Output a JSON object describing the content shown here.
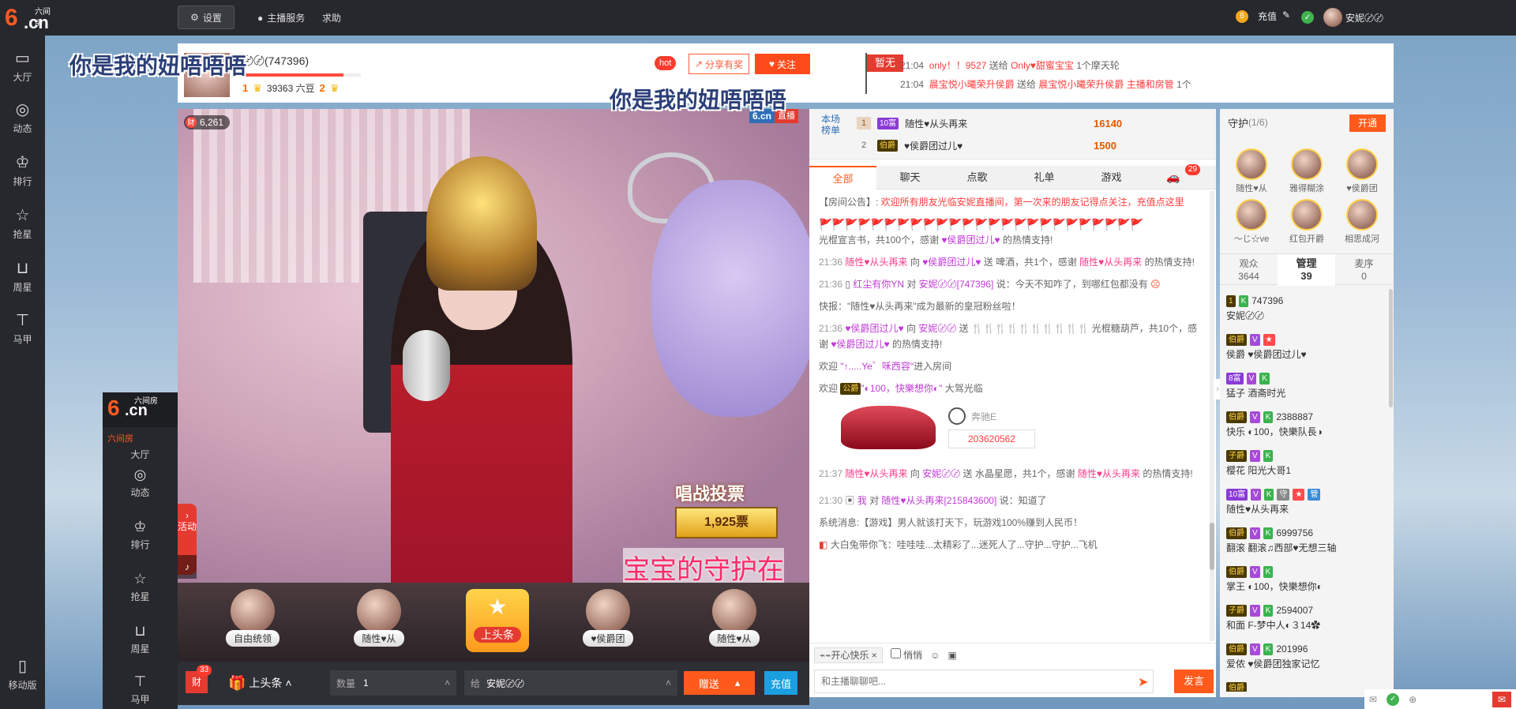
{
  "topbar": {
    "logo_num": "6",
    "logo_cn": ".cn",
    "logo_small": "六间房",
    "settings_label": "设置",
    "host_service_label": "主播服务",
    "help_label": "求助",
    "recharge_label": "充值",
    "username": "安妮〄〄"
  },
  "leftnav": {
    "items": [
      {
        "label": "大厅",
        "icon": "tv-icon"
      },
      {
        "label": "动态",
        "icon": "compass-icon"
      },
      {
        "label": "排行",
        "icon": "crown-icon"
      },
      {
        "label": "抢星",
        "icon": "star-icon"
      },
      {
        "label": "周星",
        "icon": "basket-icon"
      },
      {
        "label": "马甲",
        "icon": "shirt-icon"
      }
    ],
    "mobile_label": "移动版"
  },
  "header": {
    "anchor_name": "〄〄(747396)",
    "anchor_progress_pct": 85,
    "level_left": "1",
    "level_text": "39363 六豆",
    "level_right": "2",
    "hot_label": "hot",
    "share_label": "分享有奖",
    "follow_label": "关注",
    "flag_label": "暂无",
    "messages": [
      {
        "time": "21:04",
        "a": "only！！9527",
        "mid": " 送给 ",
        "b": "Only♥甜蜜宝宝",
        "end": " 1个摩天轮"
      },
      {
        "time": "21:04",
        "a": "晨宝悦小曦荣升侯爵",
        "mid": " 送给 ",
        "b": "晨宝悦小曦荣升侯爵 主播和房管",
        "end": " 1个"
      }
    ],
    "floating_text": "你是我的妞唔唔唔"
  },
  "video": {
    "wealth_value": "6,261",
    "wealth_icon": "财",
    "live_site": "6.cn",
    "live_label": "直播",
    "vote_title": "唱战投票",
    "vote_count": "1,925票",
    "activity_label": "活动",
    "banner_text": "宝宝的守护在"
  },
  "mini_panel": {
    "sub_label": "六间房",
    "items": [
      {
        "label": "大厅",
        "icon": "tv-icon"
      },
      {
        "label": "动态",
        "icon": "compass-icon"
      },
      {
        "label": "排行",
        "icon": "crown-icon"
      },
      {
        "label": "抢星",
        "icon": "star-icon"
      },
      {
        "label": "周星",
        "icon": "basket-icon"
      },
      {
        "label": "马甲",
        "icon": "shirt-icon"
      }
    ]
  },
  "guard_strip": {
    "seats": [
      {
        "label": "自由统领"
      },
      {
        "label": "随性♥从"
      },
      {
        "label": "♥侯爵团"
      },
      {
        "label": "随性♥从"
      }
    ],
    "headline_label": "上头条"
  },
  "gift_bar": {
    "box_label": "财",
    "badge": "33",
    "headline_label": "上头条",
    "qty_label": "数量",
    "qty_value": "1",
    "to_label": "给",
    "to_value": "安妮〄〄",
    "send_label": "赠送",
    "recharge_label": "充值"
  },
  "chat": {
    "rank_title": "本场榜单",
    "rank_rows": [
      {
        "no": "1",
        "badge": "10富",
        "name": "随性♥从头再来",
        "score": "16140"
      },
      {
        "no": "2",
        "badge": "伯爵",
        "name": "♥侯爵团过儿♥",
        "score": "1500"
      }
    ],
    "tabs": [
      "全部",
      "聊天",
      "点歌",
      "礼单",
      "游戏"
    ],
    "car_count": "29",
    "announcement_label": "【房间公告】:",
    "announcement_text": " 欢迎所有朋友光临安妮直播间，第一次来的朋友记得点关注，充值点这里",
    "m1": "光棍宣言书，共100个，感谢 ",
    "m1_user": "♥侯爵团过儿♥",
    "m1_end": " 的热情支持!",
    "m2_time": "21:36",
    "m2_a": "随性♥从头再来",
    "m2_mid": " 向 ",
    "m2_b": "♥侯爵团过儿♥",
    "m2_text": " 送  啤酒，共1个，感谢 ",
    "m2_c": "随性♥从头再来",
    "m2_end": " 的热情支持!",
    "m3_time": "21:36",
    "m3_a": "红尘有你YN",
    "m3_mid": " 对 ",
    "m3_b": "安妮〄〄[747396]",
    "m3_text": " 说：今天不知咋了，到哪红包都没有",
    "m4": "快报：\"随性♥从头再来\"成为最新的皇冠粉丝啦！",
    "m5_time": "21:36",
    "m5_a": "♥侯爵团过儿♥",
    "m5_mid": " 向 ",
    "m5_b": "安妮〄〄",
    "m5_text": " 送 ",
    "m5_flags": "🍴🍴🍴🍴🍴🍴🍴🍴🍴🍴",
    "m5_text2": " 光棍糖葫芦，共10个，感谢 ",
    "m5_c": "♥侯爵团过儿♥",
    "m5_end": " 的热情支持!",
    "m6_pre": "欢迎 ",
    "m6_user": "\"↑.....Ye゛咊西容\"",
    "m6_end": "进入房间",
    "m7_pre": "欢迎 ",
    "m7_user": "\"◐100，快樂想你◐\"",
    "m7_end": " 大驾光临",
    "car_name": "奔驰E",
    "car_number": "203620562",
    "m8_time": "21:37",
    "m8_a": "随性♥从头再来",
    "m8_mid": " 向 ",
    "m8_b": "安妮〄〄",
    "m8_text": " 送  水晶星愿，共1个，感谢 ",
    "m8_c": "随性♥从头再来",
    "m8_end": " 的热情支持!",
    "m9_time": "21:30",
    "m9_a": "我",
    "m9_mid": " 对 ",
    "m9_b": "随性♥从头再来[215843600]",
    "m9_text": " 说：知道了",
    "m10": "系统消息:【游戏】男人就该打天下，玩游戏100%赚到人民币！",
    "m11": "大白兔带你飞：哇哇哇...太精彩了...迷死人了...守护...守护...飞机",
    "tool_chip": "⌁⌁开心快乐",
    "quiet_label": "悄悄",
    "input_placeholder": "和主播聊聊吧...",
    "send_label": "发言"
  },
  "right_panel": {
    "guard_label": "守护",
    "guard_count": "(1/6)",
    "open_label": "开通",
    "guards": [
      "随性♥从",
      "雅得糊涂",
      "♥侯爵团",
      "〜じ☆ve",
      "红包开爵",
      "相思成河"
    ],
    "tabs": [
      {
        "label": "观众",
        "count": "3644"
      },
      {
        "label": "管理",
        "count": "39"
      },
      {
        "label": "麦序",
        "count": "0"
      }
    ],
    "list": [
      {
        "badges": [
          [
            "1",
            "gold"
          ],
          [
            "K",
            "green"
          ]
        ],
        "id": "747396",
        "name": "安妮〄〄"
      },
      {
        "badges": [
          [
            "伯爵",
            "gold"
          ],
          [
            "V",
            "violet"
          ],
          [
            "★",
            "red"
          ]
        ],
        "id": "",
        "name": "侯爵 ♥侯爵团过儿♥"
      },
      {
        "badges": [
          [
            "8富",
            "purple"
          ],
          [
            "V",
            "violet"
          ],
          [
            "K",
            "green"
          ]
        ],
        "id": "",
        "name": "猛子 酒斋时光"
      },
      {
        "badges": [
          [
            "伯爵",
            "gold"
          ],
          [
            "V",
            "violet"
          ],
          [
            "K",
            "green"
          ]
        ],
        "id": "2388887",
        "name": "快乐 ◐100，快樂队長◑"
      },
      {
        "badges": [
          [
            "子爵",
            "gold"
          ],
          [
            "V",
            "violet"
          ],
          [
            "K",
            "green"
          ]
        ],
        "id": "",
        "name": "樱花 阳光大哥1"
      },
      {
        "badges": [
          [
            "10富",
            "purple"
          ],
          [
            "V",
            "violet"
          ],
          [
            "K",
            "green"
          ],
          [
            "守",
            "gray"
          ],
          [
            "★",
            "red"
          ],
          [
            "管",
            "blue"
          ]
        ],
        "id": "",
        "name": "随性♥从头再来"
      },
      {
        "badges": [
          [
            "伯爵",
            "gold"
          ],
          [
            "V",
            "violet"
          ],
          [
            "K",
            "green"
          ]
        ],
        "id": "6999756",
        "name": "翻滚 翻滚♫西部♥无想三轴"
      },
      {
        "badges": [
          [
            "伯爵",
            "gold"
          ],
          [
            "V",
            "violet"
          ],
          [
            "K",
            "green"
          ]
        ],
        "id": "",
        "name": "掌王 ◐100，快樂想你◐"
      },
      {
        "badges": [
          [
            "子爵",
            "gold"
          ],
          [
            "V",
            "violet"
          ],
          [
            "K",
            "green"
          ]
        ],
        "id": "2594007",
        "name": "和面 F-梦中人◐３14✿"
      },
      {
        "badges": [
          [
            "伯爵",
            "gold"
          ],
          [
            "V",
            "violet"
          ],
          [
            "K",
            "green"
          ]
        ],
        "id": "201996",
        "name": "爱侬 ♥侯爵团独家记忆"
      },
      {
        "badges": [
          [
            "伯爵",
            "gold"
          ]
        ],
        "id": "",
        "name": ""
      }
    ]
  },
  "colors": {
    "brand_orange": "#fe5a21",
    "accent": "#ff5a1c",
    "dark_bar": "#27282d"
  }
}
